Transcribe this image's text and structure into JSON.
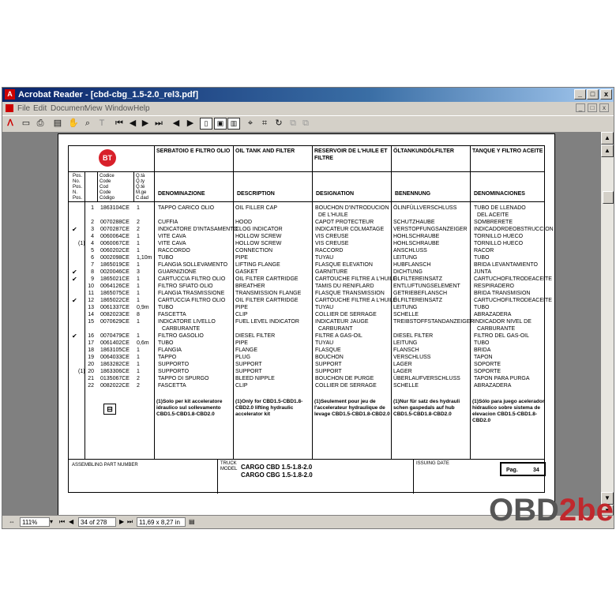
{
  "window": {
    "title": "Acrobat Reader - [cbd-cbg_1.5-2.0_rel3.pdf]",
    "min_label": "_",
    "max_label": "□",
    "close_label": "x"
  },
  "menu": [
    {
      "label": "File"
    },
    {
      "label": "Edit"
    },
    {
      "label": "Document"
    },
    {
      "label": "View"
    },
    {
      "label": "Window"
    },
    {
      "label": "Help"
    }
  ],
  "mdi_buttons": [
    "_",
    "□",
    "x"
  ],
  "toolbar_icons": [
    "adobe-icon",
    "open-icon",
    "print-icon",
    "thumbnails-icon",
    "hand-icon",
    "zoom-icon",
    "text-select-icon",
    "first-page-icon",
    "prev-page-icon",
    "next-page-icon",
    "last-page-icon",
    "back-icon",
    "forward-icon",
    "actual-size-icon",
    "fit-page-icon",
    "fit-width-icon",
    "find-icon",
    "web-icon",
    "rotate-icon",
    "tool-icon"
  ],
  "status": {
    "zoom": "111%",
    "page_info": "34 of 278",
    "page_size": "11,69 x 8,27 in"
  },
  "watermark": {
    "part1": "OBD",
    "part2": "2be"
  },
  "doc": {
    "logo": "BT",
    "titles": {
      "it": "SERBATOIO E FILTRO OLIO",
      "en": "OIL TANK AND FILTER",
      "fr": "RESERVOIR DE L'HUILE ET FILTRE",
      "de": "ÖLTANKUNDÖLFILTER",
      "es": "TANQUE Y FILTRO ACEITE"
    },
    "col_labels": {
      "pos": "Pos.\nNo.\nPos.\nN.\nPos.",
      "code": "Codice\nCode\nCod\nCode\nCódigo",
      "qty": "Q.tà\nQ.ty\nQ.té\nM.ge\nC.dad",
      "it": "DENOMINAZIONE",
      "en": "DESCRIPTION",
      "fr": "DESIGNATION",
      "de": "BENENNUNG",
      "es": "DENOMINACIONES"
    },
    "rows": [
      {
        "check": "",
        "pos": "1",
        "note": "",
        "code": "1863104CE",
        "qty": "1",
        "it": "TAPPO CARICO OLIO",
        "en": "OIL FILLER CAP",
        "fr": "BOUCHON D'INTRODUCION",
        "de": "ÖLINFÜLLVERSCHLUSS",
        "es": "TUBO DE LLENADO",
        "it2": "",
        "fr2": "DE L'HUILE",
        "es2": "DEL ACEITE"
      },
      {
        "check": "",
        "pos": "2",
        "note": "",
        "code": "0070288CE",
        "qty": "2",
        "it": "CUFFIA",
        "en": "HOOD",
        "fr": "CAPOT PROTECTEUR",
        "de": "SCHUTZHAUBE",
        "es": "SOMBRERETE"
      },
      {
        "check": "✔",
        "pos": "3",
        "note": "",
        "code": "0070287CE",
        "qty": "2",
        "it": "INDICATORE D'INTASAMENTO",
        "en": "CLOG INDICATOR",
        "fr": "INDICATEUR COLMATAGE",
        "de": "VERSTOPFUNGSANZEIGER",
        "es": "INDICADORDEOBSTRUCCION"
      },
      {
        "check": "",
        "pos": "4",
        "note": "",
        "code": "0060064CE",
        "qty": "1",
        "it": "VITE CAVA",
        "en": "HOLLOW SCREW",
        "fr": "VIS CREUSE",
        "de": "HOHLSCHRAUBE",
        "es": "TORNILLO HUECO"
      },
      {
        "check": "",
        "pos": "4",
        "note": "(1)",
        "code": "0060067CE",
        "qty": "1",
        "it": "VITE CAVA",
        "en": "HOLLOW SCREW",
        "fr": "VIS CREUSE",
        "de": "HOHLSCHRAUBE",
        "es": "TORNILLO HUECO"
      },
      {
        "check": "",
        "pos": "5",
        "note": "",
        "code": "0060202CE",
        "qty": "1",
        "it": "RACCORDO",
        "en": "CONNECTION",
        "fr": "RACCORD",
        "de": "ANSCHLUSS",
        "es": "RACOR"
      },
      {
        "check": "",
        "pos": "6",
        "note": "",
        "code": "0002098CE",
        "qty": "1,10m",
        "it": "TUBO",
        "en": "PIPE",
        "fr": "TUYAU",
        "de": "LEITUNG",
        "es": "TUBO"
      },
      {
        "check": "",
        "pos": "7",
        "note": "",
        "code": "1865019CE",
        "qty": "1",
        "it": "FLANGIA SOLLEVAMENTO",
        "en": "LIFTING FLANGE",
        "fr": "FLASQUE ELEVATION",
        "de": "HUBFLANSCH",
        "es": "BRIDA LEVANTAMIENTO"
      },
      {
        "check": "✔",
        "pos": "8",
        "note": "",
        "code": "0020046CE",
        "qty": "3",
        "it": "GUARNIZIONE",
        "en": "GASKET",
        "fr": "GARNITURE",
        "de": "DICHTUNG",
        "es": "JUNTA"
      },
      {
        "check": "✔",
        "pos": "9",
        "note": "",
        "code": "1865021CE",
        "qty": "1",
        "it": "CARTUCCIA FILTRO OLIO",
        "en": "OIL FILTER CARTRIDGE",
        "fr": "CARTOUCHE FILTRE A L'HUILE",
        "de": "ÖLFILTEREINSATZ",
        "es": "CARTUCHOFILTRODEACEITE"
      },
      {
        "check": "",
        "pos": "10",
        "note": "",
        "code": "0064126CE",
        "qty": "1",
        "it": "FILTRO SFIATO OLIO",
        "en": "BREATHER",
        "fr": "TAMIS DU RENIFLARD",
        "de": "ENTLUFTUNGSELEMENT",
        "es": "RESPIRADERO"
      },
      {
        "check": "",
        "pos": "11",
        "note": "",
        "code": "1865075CE",
        "qty": "1",
        "it": "FLANGIA TRASMISSIONE",
        "en": "TRANSMISSION FLANGE",
        "fr": "FLASQUE TRANSMISSION",
        "de": "GETRIEBEFLANSCH",
        "es": "BRIDA TRANSMISION"
      },
      {
        "check": "✔",
        "pos": "12",
        "note": "",
        "code": "1865022CE",
        "qty": "1",
        "it": "CARTUCCIA FILTRO OLIO",
        "en": "OIL FILTER CARTRIDGE",
        "fr": "CARTOUCHE FILTRE A L'HUILE",
        "de": "ÖLFILTEREINSATZ",
        "es": "CARTUCHOFILTRODEACEITE"
      },
      {
        "check": "",
        "pos": "13",
        "note": "",
        "code": "0061337CE",
        "qty": "0,9m",
        "it": "TUBO",
        "en": "PIPE",
        "fr": "TUYAU",
        "de": "LEITUNG",
        "es": "TUBO"
      },
      {
        "check": "",
        "pos": "14",
        "note": "",
        "code": "0082023CE",
        "qty": "8",
        "it": "FASCETTA",
        "en": "CLIP",
        "fr": "COLLIER DE SERRAGE",
        "de": "SCHELLE",
        "es": "ABRAZADERA"
      },
      {
        "check": "",
        "pos": "15",
        "note": "",
        "code": "0070629CE",
        "qty": "1",
        "it": "INDICATORE LIVELLO",
        "en": "FUEL LEVEL INDICATOR",
        "fr": "INDICATEUR JAUGE",
        "de": "TREIBSTOFFSTANDANZEIGER",
        "es": "INDICADOR NIVEL DE",
        "it2": "CARBURANTE",
        "fr2": "CARBURANT",
        "es2": "CARBURANTE"
      },
      {
        "check": "✔",
        "pos": "16",
        "note": "",
        "code": "0070479CE",
        "qty": "1",
        "it": "FILTRO GASOLIO",
        "en": "DIESEL FILTER",
        "fr": "FILTRE A GAS-OIL",
        "de": "DIESEL FILTER",
        "es": "FILTRO DEL GAS-OIL"
      },
      {
        "check": "",
        "pos": "17",
        "note": "",
        "code": "0061402CE",
        "qty": "0,6m",
        "it": "TUBO",
        "en": "PIPE",
        "fr": "TUYAU",
        "de": "LEITUNG",
        "es": "TUBO"
      },
      {
        "check": "",
        "pos": "18",
        "note": "",
        "code": "1863105CE",
        "qty": "1",
        "it": "FLANGIA",
        "en": "FLANGE",
        "fr": "FLASQUE",
        "de": "FLANSCH",
        "es": "BRIDA"
      },
      {
        "check": "",
        "pos": "19",
        "note": "",
        "code": "0064033CE",
        "qty": "1",
        "it": "TAPPO",
        "en": "PLUG",
        "fr": "BOUCHON",
        "de": "VERSCHLUSS",
        "es": "TAPON"
      },
      {
        "check": "",
        "pos": "20",
        "note": "",
        "code": "1863282CE",
        "qty": "1",
        "it": "SUPPORTO",
        "en": "SUPPORT",
        "fr": "SUPPORT",
        "de": "LAGER",
        "es": "SOPORTE"
      },
      {
        "check": "",
        "pos": "20",
        "note": "(1)",
        "code": "1863306CE",
        "qty": "1",
        "it": "SUPPORTO",
        "en": "SUPPORT",
        "fr": "SUPPORT",
        "de": "LAGER",
        "es": "SOPORTE"
      },
      {
        "check": "",
        "pos": "21",
        "note": "",
        "code": "0135067CE",
        "qty": "2",
        "it": "TAPPO DI SPURGO",
        "en": "BLEED NIPPLE",
        "fr": "BOUCHON DE PURGE",
        "de": "ÜBERLAUFVERSCHLUSS",
        "es": "TAPON PARA PURGA"
      },
      {
        "check": "",
        "pos": "22",
        "note": "",
        "code": "0082022CE",
        "qty": "2",
        "it": "FASCETTA",
        "en": "CLIP",
        "fr": "COLLIER DE SERRAGE",
        "de": "SCHELLE",
        "es": "ABRAZADERA"
      }
    ],
    "notes": {
      "it": "(1)Solo per kit acceleratore idraulico sul sollevamento CBD1.5-CBD1.8-CBD2.0",
      "en": "(1)Only for CBD1.5-CBD1.8-CBD2.0 lifting hydraulic accelerator kit",
      "fr": "(1)Seulement pour jeu de l'accelerateur hydraulique de levage CBD1.5-CBD1.8-CBD2.0",
      "de": "(1)Nur für satz des hydrauli schen gaspedals auf hub CBD1.5-CBD1.8-CBD2.0",
      "es": "(1)Sólo para juego acelerador hidraulico sobre sistema de elevacion CBD1.5-CBD1.8-CBD2.0"
    },
    "footer": {
      "assembling": "ASSEMBLING PART NUMBER",
      "truck_model": "TRUCK\nMODEL",
      "model1": "CARGO CBD 1.5-1.8-2.0",
      "model2": "CARGO CBG 1.5-1.8-2.0",
      "issuing": "ISSUING DATE",
      "pag_label": "Pag.",
      "pag_number": "34"
    }
  }
}
